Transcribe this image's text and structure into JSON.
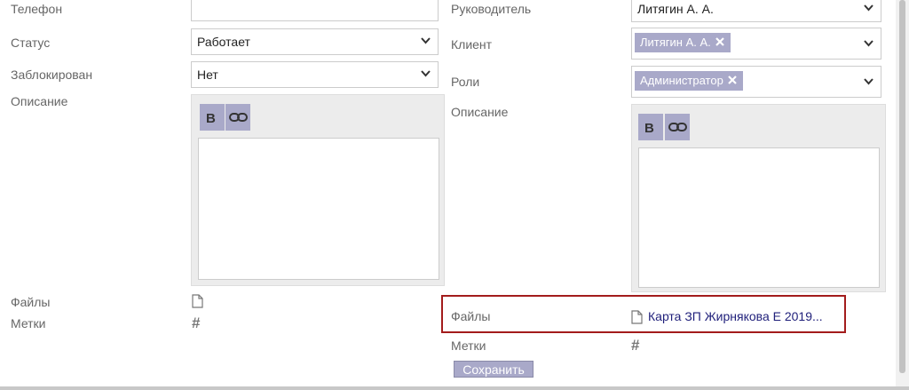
{
  "left": {
    "phone_label": "Телефон",
    "status_label": "Статус",
    "status_value": "Работает",
    "blocked_label": "Заблокирован",
    "blocked_value": "Нет",
    "description_label": "Описание",
    "files_label": "Файлы",
    "tags_label": "Метки"
  },
  "right": {
    "manager_label": "Руководитель",
    "manager_value": "Литягин А. А.",
    "client_label": "Клиент",
    "client_chip": "Литягин А. А.",
    "roles_label": "Роли",
    "roles_chip": "Администратор",
    "description_label": "Описание",
    "files_label": "Файлы",
    "file_name": "Карта ЗП Жирнякова Е 2019...",
    "tags_label": "Метки"
  },
  "actions": {
    "save_label": "Сохранить"
  },
  "editor": {
    "bold_symbol": "B"
  },
  "tags_symbol": "#",
  "icons": [
    "chevron-down-icon",
    "close-icon",
    "bold-icon",
    "link-icon",
    "file-icon",
    "hash-icon"
  ],
  "colors": {
    "chip": "#a9a9c9",
    "highlight": "#a31c1c",
    "link": "#1f1f7a"
  }
}
